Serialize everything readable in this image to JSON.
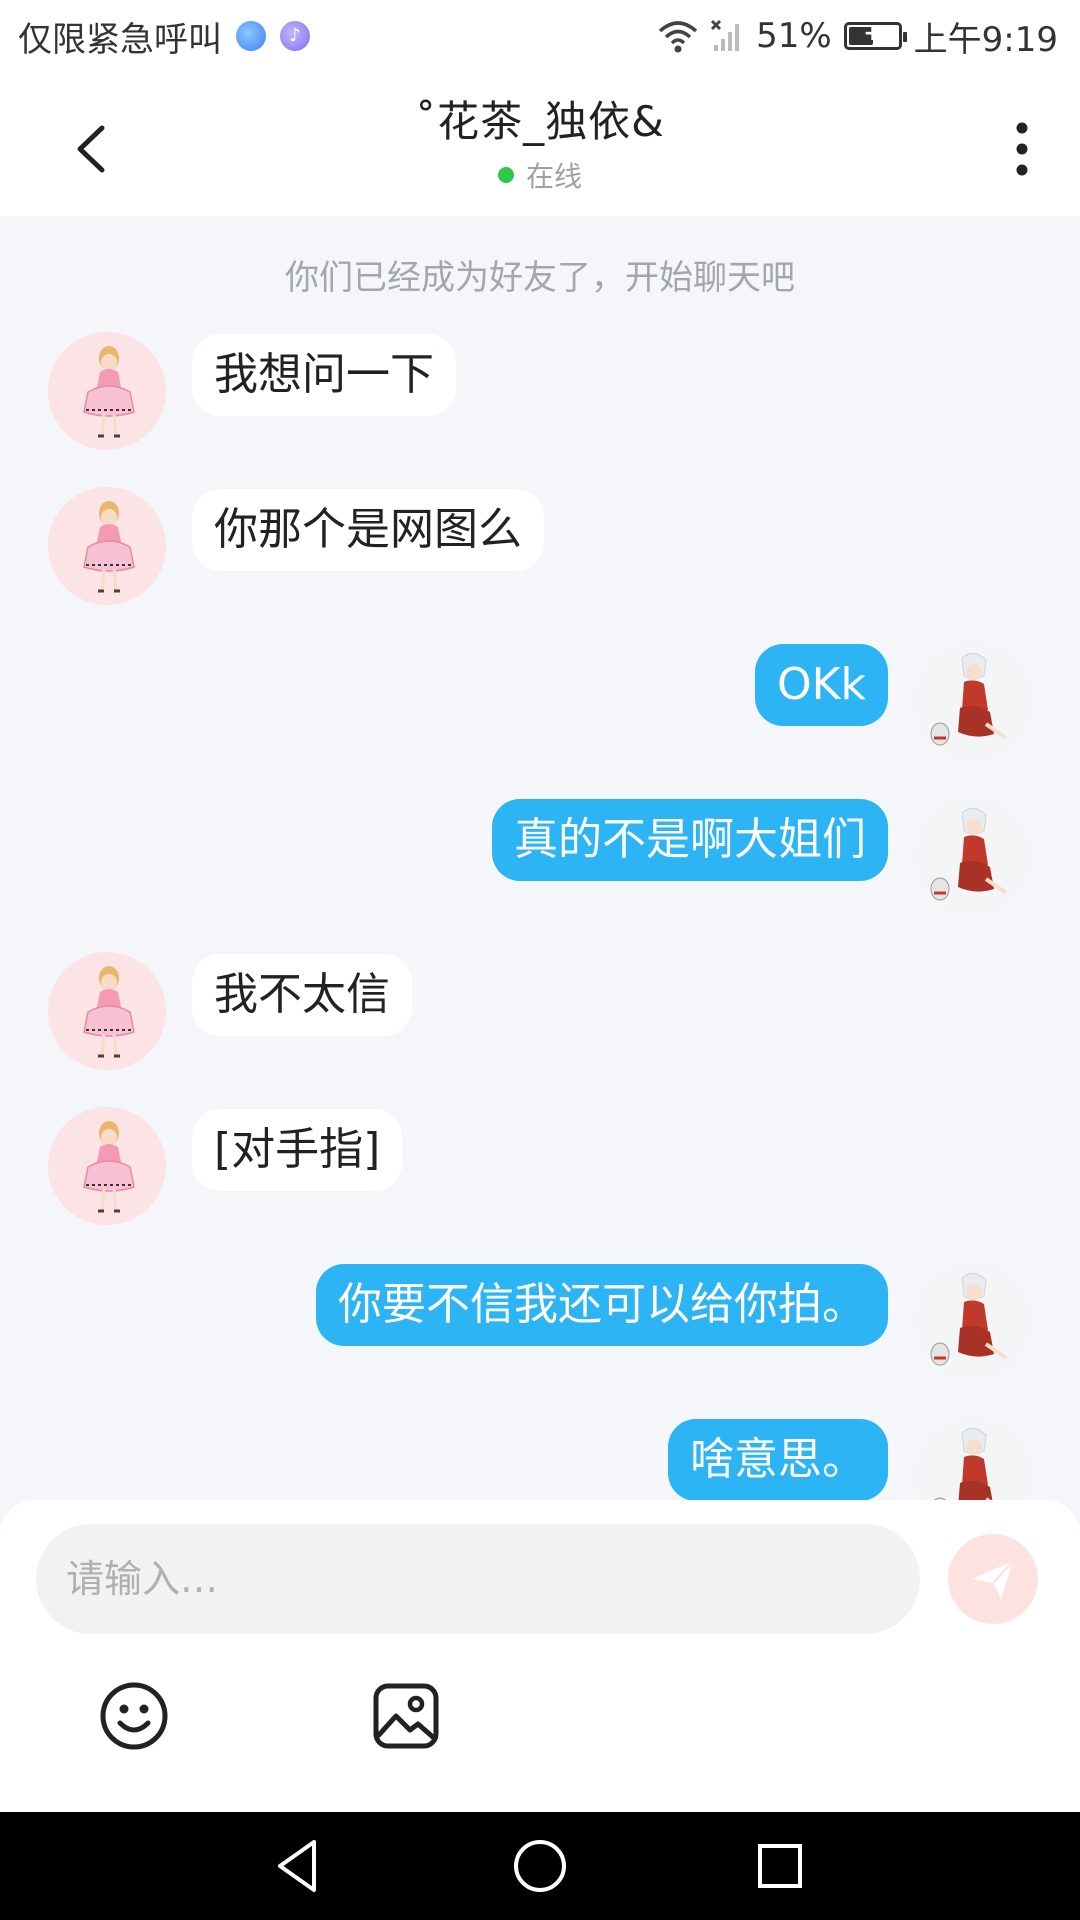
{
  "status_bar": {
    "carrier_text": "仅限紧急呼叫",
    "battery_percent": "51%",
    "battery_level": 0.51,
    "time": "上午9:19",
    "icons": [
      "globe-icon",
      "music-icon",
      "wifi-icon",
      "signal-icon",
      "battery-icon"
    ]
  },
  "header": {
    "title": "˚花茶_独依&",
    "status": "在线"
  },
  "chat": {
    "system_tip": "你们已经成为好友了，开始聊天吧",
    "messages": [
      {
        "side": "left",
        "text": "我想问一下"
      },
      {
        "side": "left",
        "text": "你那个是网图么"
      },
      {
        "side": "right",
        "text": "OKk"
      },
      {
        "side": "right",
        "text": "真的不是啊大姐们"
      },
      {
        "side": "left",
        "text": "我不太信"
      },
      {
        "side": "left",
        "text": "[对手指]"
      },
      {
        "side": "right",
        "text": "你要不信我还可以给你拍。"
      },
      {
        "side": "right",
        "text": "啥意思。"
      }
    ]
  },
  "input": {
    "placeholder": "请输入…"
  },
  "colors": {
    "accent": "#2db4f5",
    "online": "#2ec84a",
    "background": "#f4f6f9",
    "send_button": "#fde3e0"
  }
}
